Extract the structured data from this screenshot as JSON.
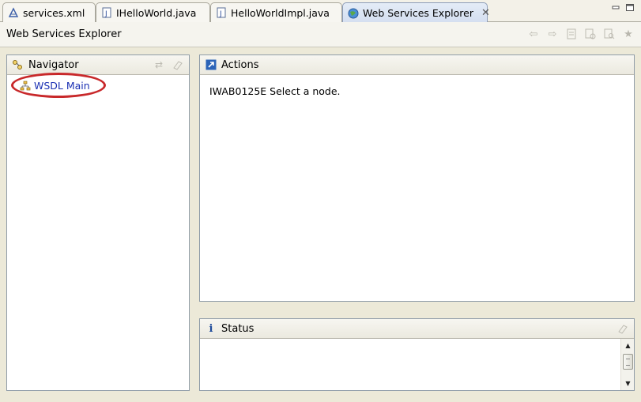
{
  "tabs": [
    {
      "label": "services.xml",
      "icon": "xml-file-icon"
    },
    {
      "label": "IHelloWorld.java",
      "icon": "java-file-icon"
    },
    {
      "label": "HelloWorldImpl.java",
      "icon": "java-file-icon"
    },
    {
      "label": "Web Services Explorer",
      "icon": "globe-icon",
      "active": true,
      "close": "✕"
    }
  ],
  "window_title": "Web Services Explorer",
  "navigator": {
    "title": "Navigator",
    "items": [
      {
        "label": "WSDL Main"
      }
    ]
  },
  "actions": {
    "title": "Actions",
    "message": "IWAB0125E Select a node."
  },
  "status": {
    "title": "Status",
    "info_glyph": "i"
  },
  "colors": {
    "link": "#1a30b3",
    "highlight_ring": "#c8282a",
    "active_tab": "#d4def0"
  }
}
